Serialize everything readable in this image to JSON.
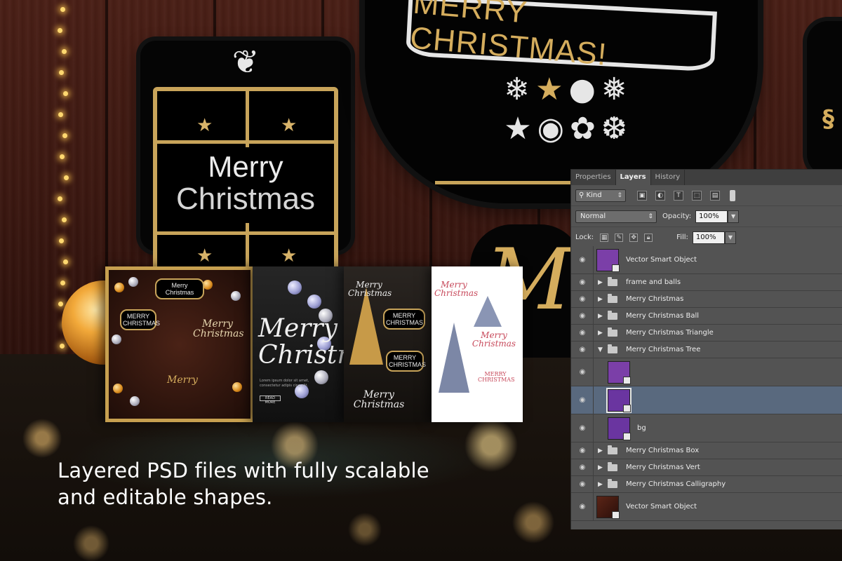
{
  "caption": {
    "line1": "Layered PSD files with fully scalable",
    "line2": "and editable shapes."
  },
  "artwork": {
    "gift_line1": "Merry",
    "gift_line2": "Christmas",
    "ribbon_text": "MERRY CHRISTMAS!",
    "calligraphy_fragment": "M",
    "thumb2_script": "Merry\nChristmas",
    "thumb2_body": "Lorem ipsum dolor sit amet, consectetur adipis cing elit.",
    "thumb2_button": "READ MORE",
    "thumb1_badge_top": "Merry Christmas",
    "thumb1_badge_mid": "MERRY CHRISTMAS",
    "thumb1_script": "Merry Christmas",
    "thumb3_script": "Merry Christmas",
    "thumb3_badge": "MERRY CHRISTMAS",
    "thumb4_script": "Merry Christmas",
    "thumb4_badge": "MERRY CHRISTMAS",
    "colors": {
      "gold": "#d5ad5d",
      "silver": "#e6e6e6",
      "wood": "#3b1710"
    }
  },
  "panel": {
    "tabs": [
      {
        "label": "Properties",
        "active": false
      },
      {
        "label": "Layers",
        "active": true
      },
      {
        "label": "History",
        "active": false
      }
    ],
    "filter": {
      "kind_label": "Kind",
      "search_icon": "search-icon"
    },
    "blend_mode": "Normal",
    "opacity_label": "Opacity:",
    "opacity_value": "100%",
    "lock_label": "Lock:",
    "fill_label": "Fill:",
    "fill_value": "100%",
    "layers": [
      {
        "name": "Vector Smart Object",
        "type": "smart-object"
      },
      {
        "name": "frame and balls",
        "type": "group",
        "expanded": false
      },
      {
        "name": "Merry Christmas",
        "type": "group",
        "expanded": false
      },
      {
        "name": "Merry Christmas Ball",
        "type": "group",
        "expanded": false
      },
      {
        "name": "Merry Christmas Triangle",
        "type": "group",
        "expanded": false
      },
      {
        "name": "Merry Christmas Tree",
        "type": "group",
        "expanded": true
      },
      {
        "name": "",
        "type": "smart-object-child"
      },
      {
        "name": "",
        "type": "smart-object-child",
        "selected": true
      },
      {
        "name": "bg",
        "type": "smart-object-child"
      },
      {
        "name": "Merry Christmas Box",
        "type": "group",
        "expanded": false
      },
      {
        "name": "Merry Christmas Vert",
        "type": "group",
        "expanded": false
      },
      {
        "name": "Merry Christmas Calligraphy",
        "type": "group",
        "expanded": false
      },
      {
        "name": "Vector Smart Object",
        "type": "smart-object"
      }
    ]
  }
}
